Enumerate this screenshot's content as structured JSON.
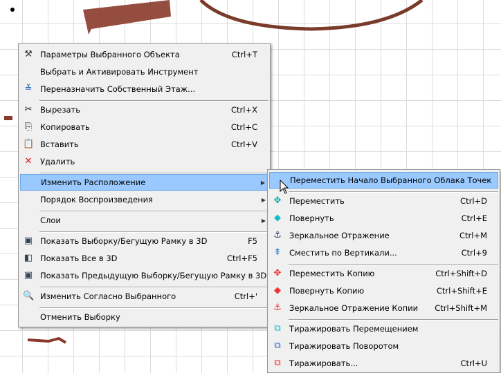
{
  "context_menu": {
    "items": [
      {
        "type": "item",
        "icon": "settings-hammer-icon",
        "glyph": "⚒",
        "color": "#333",
        "label": "Параметры Выбранного Объекта",
        "shortcut": "Ctrl+T"
      },
      {
        "type": "item",
        "icon": "",
        "glyph": "",
        "label": "Выбрать и Активировать Инструмент",
        "shortcut": ""
      },
      {
        "type": "item",
        "icon": "story-icon",
        "glyph": "≚",
        "color": "#1a5fb4",
        "label": "Переназначить Собственный Этаж...",
        "shortcut": ""
      },
      {
        "type": "sep"
      },
      {
        "type": "item",
        "icon": "scissors-icon",
        "glyph": "✂",
        "color": "#223",
        "label": "Вырезать",
        "shortcut": "Ctrl+X"
      },
      {
        "type": "item",
        "icon": "copy-icon",
        "glyph": "⎘",
        "color": "#223",
        "label": "Копировать",
        "shortcut": "Ctrl+C"
      },
      {
        "type": "item",
        "icon": "paste-icon",
        "glyph": "📋",
        "color": "#7a5",
        "label": "Вставить",
        "shortcut": "Ctrl+V"
      },
      {
        "type": "item",
        "icon": "delete-icon",
        "glyph": "✕",
        "color": "#e01010",
        "label": "Удалить",
        "shortcut": ""
      },
      {
        "type": "sep"
      },
      {
        "type": "item",
        "icon": "",
        "glyph": "",
        "label": "Изменить Расположение",
        "shortcut": "",
        "submenu": true,
        "highlight": true
      },
      {
        "type": "item",
        "icon": "",
        "glyph": "",
        "label": "Порядок Воспроизведения",
        "shortcut": "",
        "submenu": true
      },
      {
        "type": "sep"
      },
      {
        "type": "item",
        "icon": "",
        "glyph": "",
        "label": "Слои",
        "shortcut": "",
        "submenu": true
      },
      {
        "type": "sep"
      },
      {
        "type": "item",
        "icon": "show-selection-3d-icon",
        "glyph": "▣",
        "color": "#345",
        "label": "Показать Выборку/Бегущую Рамку в 3D",
        "shortcut": "F5"
      },
      {
        "type": "item",
        "icon": "show-all-3d-icon",
        "glyph": "◧",
        "color": "#345",
        "label": "Показать Все в 3D",
        "shortcut": "Ctrl+F5"
      },
      {
        "type": "item",
        "icon": "show-previous-3d-icon",
        "glyph": "▣",
        "color": "#345",
        "label": "Показать Предыдущую Выборку/Бегущую Рамку в 3D",
        "shortcut": ""
      },
      {
        "type": "sep"
      },
      {
        "type": "item",
        "icon": "zoom-to-selection-icon",
        "glyph": "🔍",
        "color": "#345",
        "label": "Изменить Согласно Выбранного",
        "shortcut": "Ctrl+'"
      },
      {
        "type": "sep"
      },
      {
        "type": "item",
        "icon": "",
        "glyph": "",
        "label": "Отменить Выборку",
        "shortcut": ""
      }
    ]
  },
  "submenu": {
    "items": [
      {
        "type": "item",
        "icon": "",
        "glyph": "",
        "label": "Переместить Начало Выбранного Облака Точек",
        "shortcut": "",
        "highlight": true
      },
      {
        "type": "sep"
      },
      {
        "type": "item",
        "icon": "move-icon",
        "glyph": "✥",
        "color": "#0aa",
        "label": "Переместить",
        "shortcut": "Ctrl+D"
      },
      {
        "type": "item",
        "icon": "rotate-icon",
        "glyph": "◆",
        "color": "#1bc",
        "label": "Повернуть",
        "shortcut": "Ctrl+E"
      },
      {
        "type": "item",
        "icon": "mirror-icon",
        "glyph": "⚓",
        "color": "#236",
        "label": "Зеркальное Отражение",
        "shortcut": "Ctrl+M"
      },
      {
        "type": "item",
        "icon": "elevate-icon",
        "glyph": "⇞",
        "color": "#1a7fd0",
        "label": "Сместить по Вертикали...",
        "shortcut": "Ctrl+9"
      },
      {
        "type": "sep"
      },
      {
        "type": "item",
        "icon": "move-copy-icon",
        "glyph": "✥",
        "color": "#e33",
        "label": "Переместить Копию",
        "shortcut": "Ctrl+Shift+D"
      },
      {
        "type": "item",
        "icon": "rotate-copy-icon",
        "glyph": "◆",
        "color": "#e33",
        "label": "Повернуть Копию",
        "shortcut": "Ctrl+Shift+E"
      },
      {
        "type": "item",
        "icon": "mirror-copy-icon",
        "glyph": "⚓",
        "color": "#e33",
        "label": "Зеркальное Отражение Копии",
        "shortcut": "Ctrl+Shift+M"
      },
      {
        "type": "sep"
      },
      {
        "type": "item",
        "icon": "multiply-move-icon",
        "glyph": "⧉",
        "color": "#1bc",
        "label": "Тиражировать Перемещением",
        "shortcut": ""
      },
      {
        "type": "item",
        "icon": "multiply-rotate-icon",
        "glyph": "⧉",
        "color": "#36c",
        "label": "Тиражировать Поворотом",
        "shortcut": ""
      },
      {
        "type": "item",
        "icon": "multiply-icon",
        "glyph": "⧉",
        "color": "#e33",
        "label": "Тиражировать...",
        "shortcut": "Ctrl+U"
      }
    ]
  }
}
